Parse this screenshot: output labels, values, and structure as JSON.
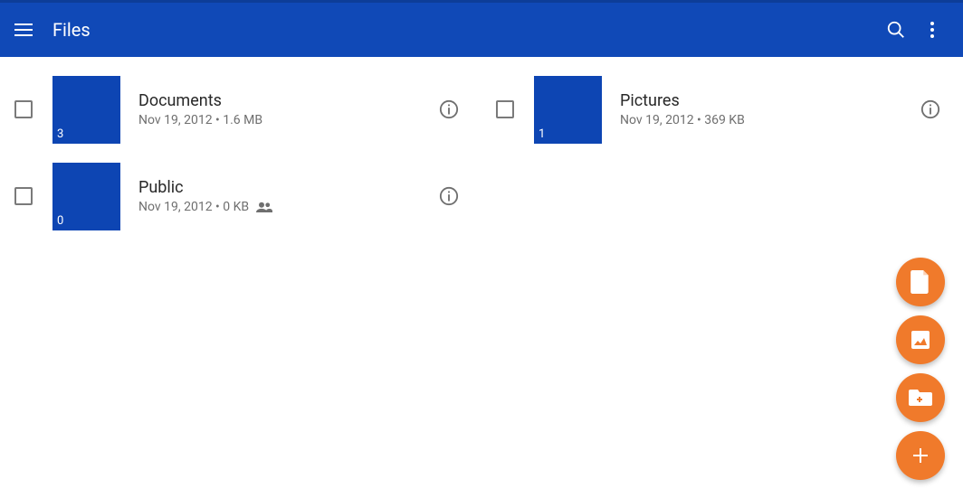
{
  "header": {
    "title": "Files"
  },
  "items": [
    {
      "name": "Documents",
      "date": "Nov 19, 2012",
      "size": "1.6 MB",
      "count": "3",
      "shared": false
    },
    {
      "name": "Pictures",
      "date": "Nov 19, 2012",
      "size": "369 KB",
      "count": "1",
      "shared": false
    },
    {
      "name": "Public",
      "date": "Nov 19, 2012",
      "size": "0 KB",
      "count": "0",
      "shared": true
    }
  ],
  "colors": {
    "primary": "#1049b7",
    "folder": "#0d45b3",
    "fab": "#f07a2b"
  },
  "fab_actions": [
    "upload-file",
    "upload-image",
    "new-folder",
    "add"
  ]
}
